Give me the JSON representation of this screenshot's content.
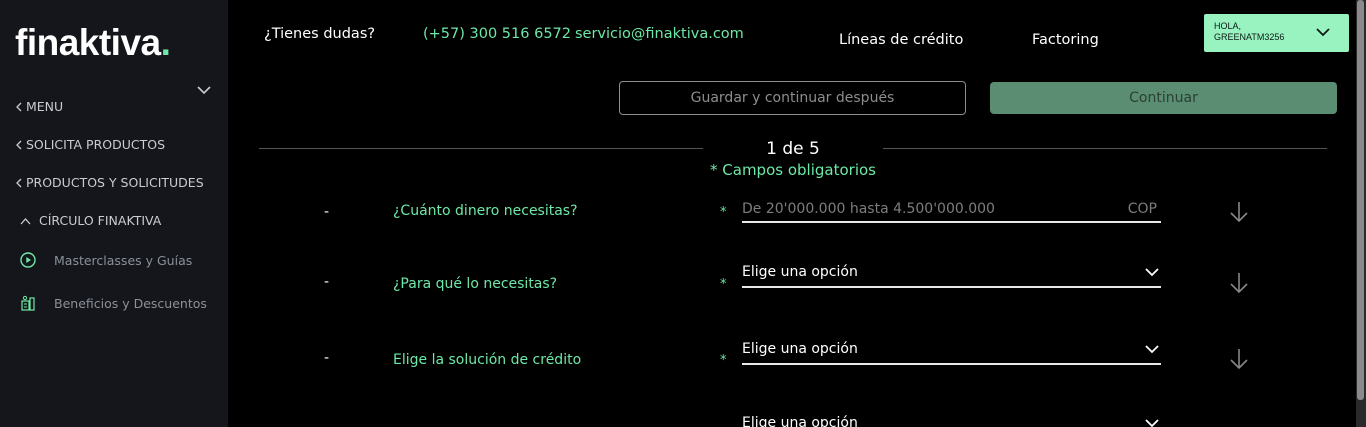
{
  "sidebar": {
    "logo_text": "finaktiva",
    "logo_dot": ".",
    "menu_label": "MENU",
    "items": [
      {
        "label": "SOLICITA PRODUCTOS"
      },
      {
        "label": "PRODUCTOS Y SOLICITUDES"
      },
      {
        "label": "CÍRCULO FINAKTIVA"
      }
    ],
    "subitems": [
      {
        "label": "Masterclasses y Guías",
        "icon": "play-circle-icon"
      },
      {
        "label": "Beneficios y Descuentos",
        "icon": "benefits-icon"
      }
    ]
  },
  "header": {
    "doubts": "¿Tienes dudas?",
    "phone": "(+57) 300 516 6572",
    "email": "servicio@finaktiva.com",
    "nav": [
      "Líneas de crédito",
      "Factoring"
    ],
    "user_greeting": "HOLA,",
    "user_name": "GREENATM3256"
  },
  "actions": {
    "save_label": "Guardar y continuar después",
    "continue_label": "Continuar"
  },
  "form": {
    "step": "1 de 5",
    "required_note": "* Campos obligatorios",
    "questions": [
      {
        "dash": "-",
        "label": "¿Cuánto dinero necesitas?",
        "star": "*",
        "placeholder": "De 20'000.000 hasta 4.500'000.000",
        "unit": "COP"
      },
      {
        "dash": "-",
        "label": "¿Para qué lo necesitas?",
        "star": "*",
        "value": "Elige una opción"
      },
      {
        "dash": "-",
        "label": "Elige la solución de crédito",
        "star": "*",
        "value": "Elige una opción"
      },
      {
        "value": "Elige una opción"
      }
    ]
  },
  "colors": {
    "accent": "#6ee8a6",
    "sidebar_bg": "#14161b",
    "page_bg": "#000000",
    "continue_bg": "#5a8d72",
    "user_chip_bg": "#98f3c1"
  }
}
